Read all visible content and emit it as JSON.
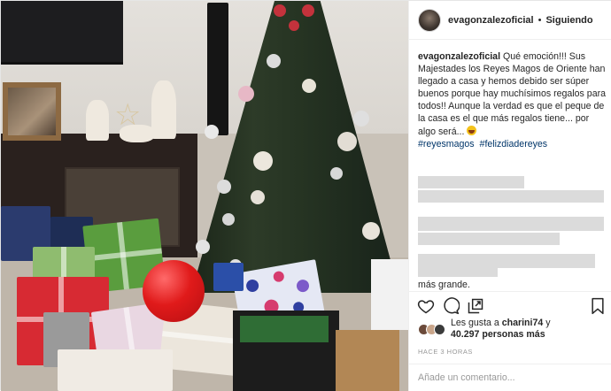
{
  "post": {
    "username": "evagonzalezoficial",
    "follow_label": "Siguiendo",
    "separator": "•",
    "caption": {
      "username": "evagonzalezoficial",
      "text": "Qué emoción!!! Sus Majestades los Reyes Magos de Oriente han llegado a casa y hemos debido ser súper buenos porque hay muchísimos regalos para todos!! Aunque la verdad es que el peque de la casa es el que más regalos tiene... por algo será..."
    },
    "hashtags": [
      "#reyesmagos",
      "#felizdiadereyes"
    ],
    "hidden_comment_tail": "más grande.",
    "likes": {
      "prefix": "Les gusta a",
      "user": "charini74",
      "connector": "y",
      "count": "40.297 personas más"
    },
    "timestamp": "HACE 3 HORAS",
    "comment_placeholder": "Añade un comentario..."
  },
  "icons": {
    "like": "heart-icon",
    "comment": "comment-bubble-icon",
    "share": "share-icon",
    "save": "bookmark-icon"
  },
  "colors": {
    "link": "#003569",
    "text": "#262626",
    "muted": "#999999",
    "balloon": "#e01a1a"
  }
}
